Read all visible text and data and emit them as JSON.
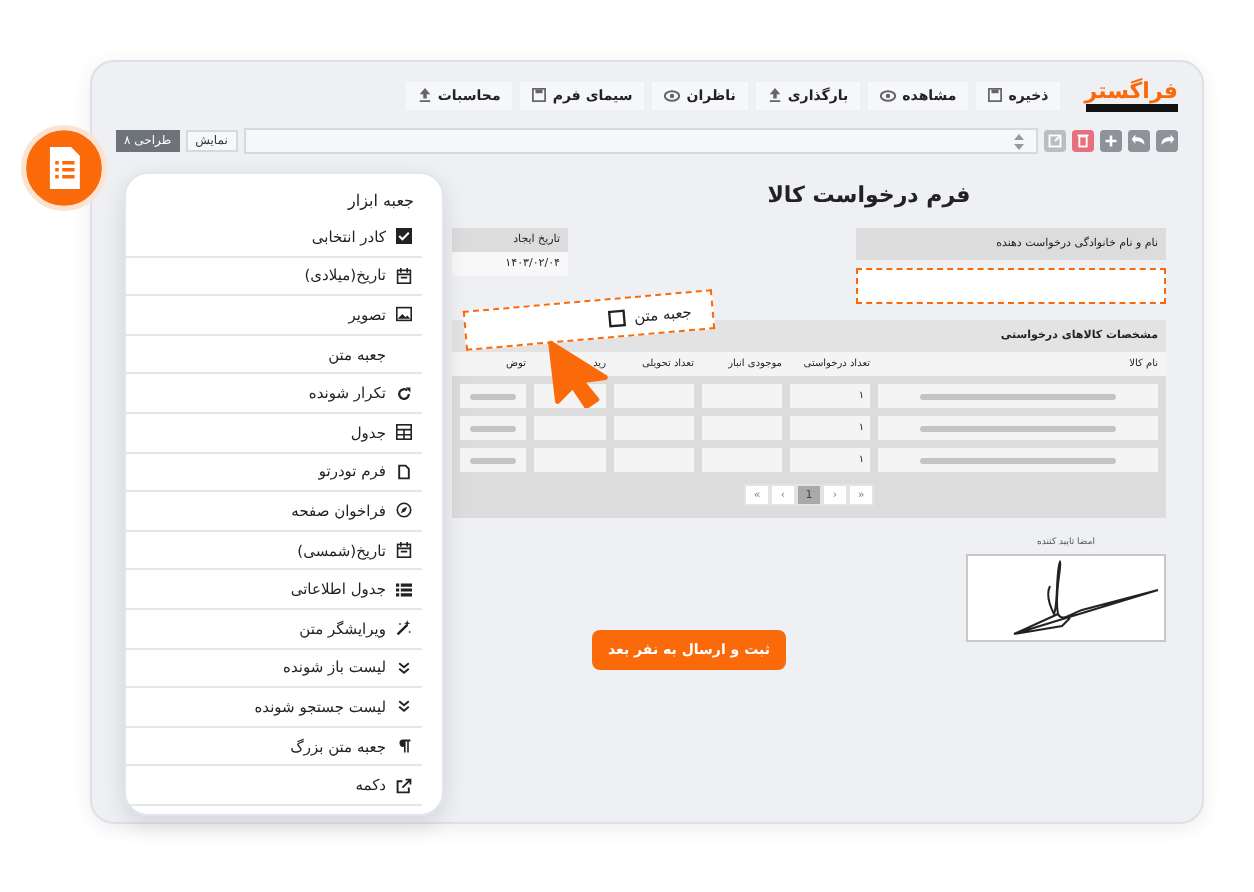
{
  "app": {
    "logo": "فراگستر",
    "menu": [
      {
        "label": "ذخیره",
        "kind": "save"
      },
      {
        "label": "مشاهده",
        "kind": "eye"
      },
      {
        "label": "بارگذاری",
        "kind": "upload"
      },
      {
        "label": "ناظران",
        "kind": "eye"
      },
      {
        "label": "سیمای فرم",
        "kind": "save"
      },
      {
        "label": "محاسبات",
        "kind": "upload"
      }
    ],
    "view_button": "نمایش",
    "design_button": "طراحی ۸"
  },
  "form": {
    "title": "فرم درخواست کالا",
    "requester": {
      "label": "نام و نام خانوادگی درخواست دهنده"
    },
    "created": {
      "label": "تاریخ ایجاد",
      "value": "۱۴۰۳/۰۲/۰۴"
    },
    "items_table": {
      "title": "مشخصات کالاهای درخواستی",
      "columns": [
        "نام کالا",
        "تعداد درخواستی",
        "موجودی انبار",
        "تعداد تحویلی",
        "رید",
        "توض"
      ],
      "rows": [
        {
          "quantity": "۱"
        },
        {
          "quantity": "۱"
        },
        {
          "quantity": "۱"
        }
      ],
      "pages": [
        {
          "label": "»",
          "selected": false
        },
        {
          "label": "›",
          "selected": false
        },
        {
          "label": "1",
          "selected": true
        },
        {
          "label": "‹",
          "selected": false
        },
        {
          "label": "«",
          "selected": false
        }
      ]
    },
    "signature": {
      "label": "امضا تایید کننده"
    },
    "submit": "ثبت و ارسال به نفر بعد"
  },
  "toolbox": {
    "title": "جعبه ابزار",
    "items": [
      {
        "label": "کادر انتخابی",
        "kind": "checkbox"
      },
      {
        "label": "تاریخ(میلادی)",
        "kind": "calendar"
      },
      {
        "label": "تصویر",
        "kind": "image"
      },
      {
        "label": "جعبه متن",
        "kind": "none"
      },
      {
        "label": "تکرار شونده",
        "kind": "repeat"
      },
      {
        "label": "جدول",
        "kind": "table"
      },
      {
        "label": "فرم تودرتو",
        "kind": "file"
      },
      {
        "label": "فراخوان صفحه",
        "kind": "compass"
      },
      {
        "label": "تاریخ(شمسی)",
        "kind": "calendar"
      },
      {
        "label": "جدول اطلاعاتی",
        "kind": "list"
      },
      {
        "label": "ویرایشگر متن",
        "kind": "wand"
      },
      {
        "label": "لیست باز شونده",
        "kind": "chevrons"
      },
      {
        "label": "لیست جستجو شونده",
        "kind": "chevrons"
      },
      {
        "label": "جعبه متن بزرگ",
        "kind": "paragraph"
      },
      {
        "label": "دکمه",
        "kind": "external"
      }
    ]
  },
  "dragged_item": {
    "label": "جعبه متن"
  }
}
